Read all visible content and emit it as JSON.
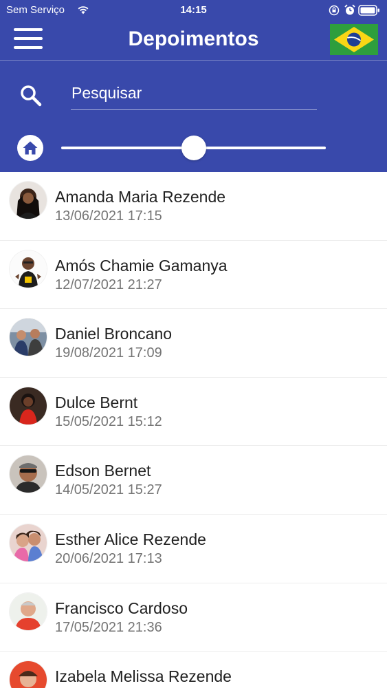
{
  "status_bar": {
    "carrier": "Sem Serviço",
    "time": "14:15"
  },
  "header": {
    "title": "Depoimentos",
    "language_flag": "brazil-flag-icon"
  },
  "search": {
    "placeholder": "Pesquisar",
    "value": ""
  },
  "slider": {
    "value_fraction": 0.5
  },
  "colors": {
    "header_bg": "#3949ab",
    "text_primary": "#212121",
    "text_secondary": "#757575"
  },
  "testimonials": [
    {
      "name": "Amanda Maria Rezende",
      "date": "13/06/2021 17:15"
    },
    {
      "name": "Amós Chamie Gamanya",
      "date": "12/07/2021 21:27"
    },
    {
      "name": "Daniel Broncano",
      "date": "19/08/2021 17:09"
    },
    {
      "name": "Dulce Bernt",
      "date": "15/05/2021 15:12"
    },
    {
      "name": "Edson Bernet",
      "date": "14/05/2021 15:27"
    },
    {
      "name": "Esther Alice Rezende",
      "date": "20/06/2021 17:13"
    },
    {
      "name": "Francisco Cardoso",
      "date": "17/05/2021 21:36"
    },
    {
      "name": "Izabela Melissa Rezende",
      "date": ""
    }
  ]
}
